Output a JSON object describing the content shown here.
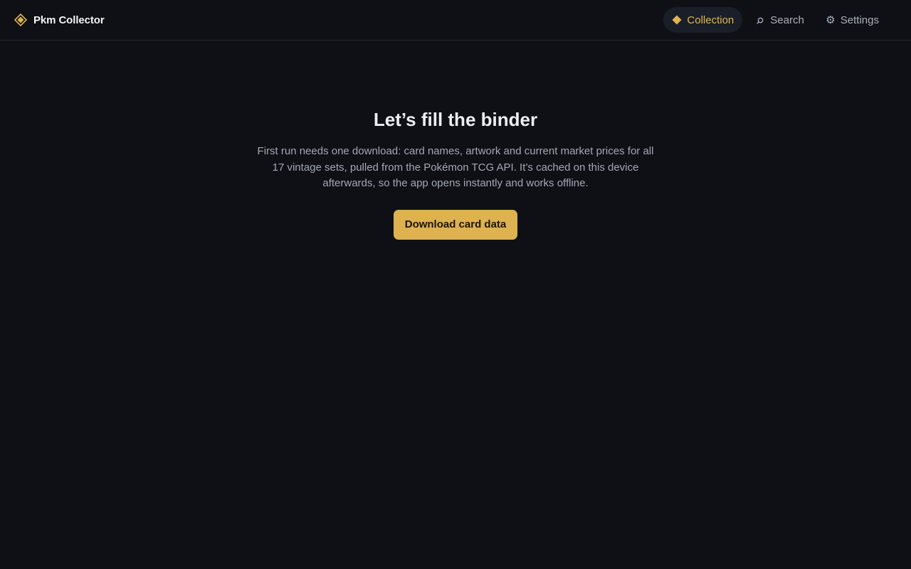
{
  "app": {
    "title": "Pkm Collector",
    "accent_color": "#ddb24f",
    "background_color": "#0f1015",
    "brand_icon": "diamond-logo-icon"
  },
  "nav": {
    "items": [
      {
        "label": "Collection",
        "icon": "diamond-icon",
        "active": true
      },
      {
        "label": "Search",
        "icon": "search-icon",
        "active": false
      },
      {
        "label": "Settings",
        "icon": "gear-icon",
        "active": false
      }
    ]
  },
  "onboarding": {
    "title": "Let’s fill the binder",
    "description": "First run needs one download: card names, artwork and current market prices for all 17 vintage sets, pulled from the Pokémon TCG API. It’s cached on this device afterwards, so the app opens instantly and works offline.",
    "button_label": "Download card data"
  }
}
